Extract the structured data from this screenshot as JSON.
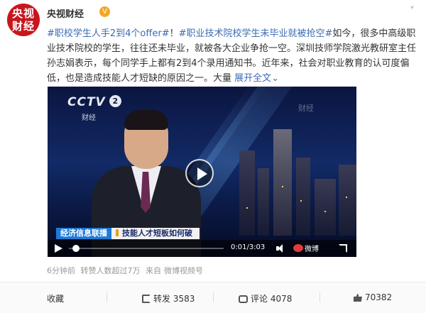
{
  "header": {
    "avatar_line1": "央视",
    "avatar_line2": "财经",
    "username": "央视财经",
    "verify_symbol": "V",
    "menu_symbol": "˅"
  },
  "post": {
    "tag1": "#职校学生人手2到4个offer#",
    "excl": "！",
    "tag2": "#职业技术院校学生未毕业就被抢空#",
    "body": "如今，很多中高级职业技术院校的学生，往往还未毕业，就被各大企业争抢一空。深圳技师学院激光教研室主任孙志娟表示，每个同学手上都有2到4个录用通知书。近年来，社会对职业教育的认可度偏低，也是造成技能人才短缺的原因之一。大量",
    "more": "展开全文",
    "more_arrow": "⌄"
  },
  "video": {
    "channel": "CCTV",
    "channel_num": "2",
    "channel_sub": "财经",
    "watermark": "财经",
    "ticker_left": "经济信息联播",
    "ticker_right": "技能人才短板如何破",
    "time": "0:01/3:03",
    "progress_fraction": 0.005,
    "weibo_label": "微博"
  },
  "meta": {
    "time_ago": "6分钟前",
    "reposts": "转赞人数超过7万",
    "source_prefix": "来自",
    "source": "微博视频号"
  },
  "actions": {
    "favorite": "收藏",
    "repost_label": "转发",
    "repost_count": "3583",
    "comment_label": "评论",
    "comment_count": "4078",
    "like_count": "70382"
  },
  "colors": {
    "brand_red": "#c8161d",
    "link_blue": "#3b6bb5"
  }
}
